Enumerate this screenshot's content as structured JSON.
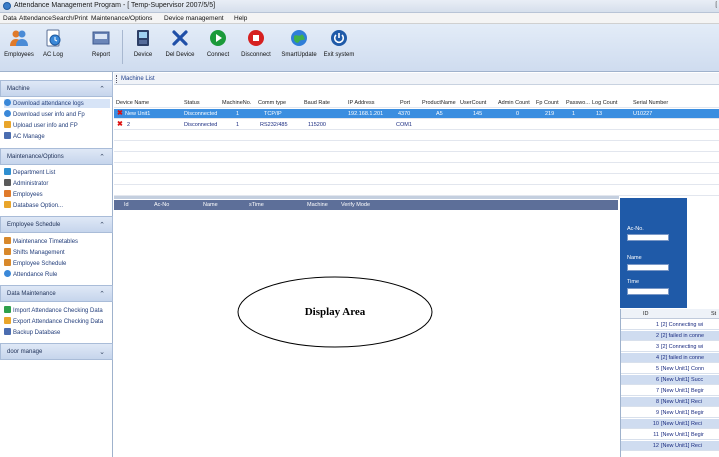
{
  "window": {
    "title": "Attendance Management Program - [ Temp-Supervisor 2007/5/5]",
    "right_mark": "["
  },
  "menu": [
    "Data",
    "Attendance",
    "Search/Print",
    "Maintenance/Options",
    "Device management",
    "Help"
  ],
  "toolbar": [
    {
      "label": "Employees",
      "icon": "employees-icon"
    },
    {
      "label": "AC Log",
      "icon": "ac-log-icon"
    },
    {
      "label": "Report",
      "icon": "report-icon"
    },
    {
      "label": "Device",
      "icon": "device-icon"
    },
    {
      "label": "Del Device",
      "icon": "delete-device-icon"
    },
    {
      "label": "Connect",
      "icon": "connect-icon"
    },
    {
      "label": "Disconnect",
      "icon": "disconnect-icon"
    },
    {
      "label": "SmartUpdate",
      "icon": "globe-icon"
    },
    {
      "label": "Exit system",
      "icon": "power-icon"
    }
  ],
  "sidebar": {
    "machine": {
      "title": "Machine",
      "items": [
        "Download attendance logs",
        "Download user info and Fp",
        "Upload user info and FP",
        "AC Manage"
      ]
    },
    "maintenance": {
      "title": "Maintenance/Options",
      "items": [
        "Department List",
        "Administrator",
        "Employees",
        "Database Option..."
      ]
    },
    "schedule": {
      "title": "Employee Schedule",
      "items": [
        "Maintenance Timetables",
        "Shifts Management",
        "Employee Schedule",
        "Attendance Rule"
      ]
    },
    "data_maintenance": {
      "title": "Data Maintenance",
      "items": [
        "Import Attendance Checking Data",
        "Export Attendance Checking Data",
        "Backup Database"
      ]
    },
    "door": {
      "title": "door manage"
    }
  },
  "machine_list": {
    "title": "Machine List",
    "columns": [
      "Device Name",
      "Status",
      "MachineNo.",
      "Comm type",
      "Baud Rate",
      "IP Address",
      "Port",
      "ProductName",
      "UserCount",
      "Admin Count",
      "Fp Count",
      "Passwo...",
      "Log Count",
      "Serial Number"
    ],
    "rows": [
      [
        "New Unit1",
        "Disconnected",
        "1",
        "TCP/IP",
        "",
        "192.168.1.201",
        "4370",
        "A5",
        "145",
        "0",
        "219",
        "1",
        "13",
        "U10227"
      ],
      [
        "2",
        "Disconnected",
        "1",
        "RS232/485",
        "115200",
        "",
        "COM1",
        "",
        "",
        "",
        "",
        "",
        "",
        ""
      ]
    ]
  },
  "records": {
    "columns": [
      "Id",
      "Ac-No",
      "Name",
      "sTime",
      "Machine",
      "Verify Mode"
    ]
  },
  "display_area": "Display Area",
  "right_panel": {
    "ac_no_label": "Ac-No.",
    "name_label": "Name",
    "time_label": "Time"
  },
  "log": {
    "columns": [
      "ID",
      "St"
    ],
    "rows": [
      {
        "id": "1",
        "status": "[2] Connecting wi"
      },
      {
        "id": "2",
        "status": "[2] failed in conne"
      },
      {
        "id": "3",
        "status": "[2] Connecting wi"
      },
      {
        "id": "4",
        "status": "[2] failed in conne"
      },
      {
        "id": "5",
        "status": "[New Unit1] Conn"
      },
      {
        "id": "6",
        "status": "[New Unit1] Succ"
      },
      {
        "id": "7",
        "status": "[New Unit1] Begir"
      },
      {
        "id": "8",
        "status": "[New Unit1] Reci"
      },
      {
        "id": "9",
        "status": "[New Unit1] Begir"
      },
      {
        "id": "10",
        "status": "[New Unit1] Reci"
      },
      {
        "id": "11",
        "status": "[New Unit1] Begir"
      },
      {
        "id": "12",
        "status": "[New Unit1] Reci"
      }
    ]
  }
}
